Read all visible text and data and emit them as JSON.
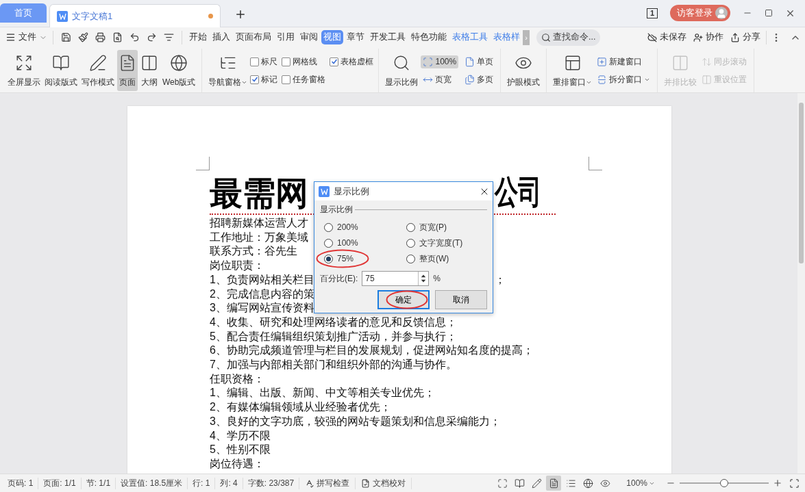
{
  "tabs": [
    {
      "label": "首页",
      "selected": false,
      "modified": false
    },
    {
      "label": "文字文稿1",
      "selected": true,
      "modified": true
    }
  ],
  "page_count_badge": "1",
  "login_button": "访客登录",
  "file_menu": "文件",
  "menu_tabs": [
    {
      "label": "开始",
      "selected": false,
      "contextual": false
    },
    {
      "label": "插入",
      "selected": false,
      "contextual": false
    },
    {
      "label": "页面布局",
      "selected": false,
      "contextual": false
    },
    {
      "label": "引用",
      "selected": false,
      "contextual": false
    },
    {
      "label": "审阅",
      "selected": false,
      "contextual": false
    },
    {
      "label": "视图",
      "selected": true,
      "contextual": false
    },
    {
      "label": "章节",
      "selected": false,
      "contextual": false
    },
    {
      "label": "开发工具",
      "selected": false,
      "contextual": false
    },
    {
      "label": "特色功能",
      "selected": false,
      "contextual": false
    },
    {
      "label": "表格工具",
      "selected": false,
      "contextual": true
    },
    {
      "label": "表格样",
      "selected": false,
      "contextual": true
    }
  ],
  "more_tabs": "›",
  "command_search": {
    "placeholder": "查找命令..."
  },
  "actions": [
    "未保存",
    "协作",
    "分享"
  ],
  "ribbon": {
    "groups": [
      {
        "items": [
          {
            "kind": "large",
            "label": "全屏显示",
            "selected": false
          },
          {
            "kind": "large",
            "label": "阅读版式",
            "selected": false
          },
          {
            "kind": "large",
            "label": "写作模式",
            "selected": false
          },
          {
            "kind": "large",
            "label": "页面",
            "selected": true
          },
          {
            "kind": "large",
            "label": "大纲",
            "selected": false
          },
          {
            "kind": "large",
            "label": "Web版式",
            "selected": false
          }
        ]
      },
      {
        "items": [
          {
            "kind": "large",
            "label": "导航窗格",
            "dropdown": true
          },
          {
            "kind": "check",
            "label": "标尺",
            "checked": false
          },
          {
            "kind": "check",
            "label": "标记",
            "checked": true
          },
          {
            "kind": "check",
            "label": "网格线",
            "checked": false
          },
          {
            "kind": "check",
            "label": "任务窗格",
            "checked": false
          },
          {
            "kind": "check",
            "label": "表格虚框",
            "checked": true
          }
        ]
      },
      {
        "items": [
          {
            "kind": "large",
            "label": "显示比例"
          },
          {
            "kind": "small",
            "label": "100%",
            "selected": true
          },
          {
            "kind": "small",
            "label": "页宽",
            "selected": false
          },
          {
            "kind": "small",
            "label": "单页",
            "selected": false
          },
          {
            "kind": "small",
            "label": "多页",
            "selected": false
          }
        ]
      },
      {
        "items": [
          {
            "kind": "large",
            "label": "护眼模式"
          }
        ]
      },
      {
        "items": [
          {
            "kind": "large",
            "label": "重排窗口",
            "dropdown": true
          },
          {
            "kind": "small",
            "label": "新建窗口",
            "dropdown": false
          },
          {
            "kind": "small",
            "label": "拆分窗口",
            "dropdown": true
          }
        ]
      },
      {
        "items": [
          {
            "kind": "large",
            "label": "并排比较",
            "disabled": true
          },
          {
            "kind": "small",
            "label": "同步滚动",
            "disabled": true
          },
          {
            "kind": "small",
            "label": "重设位置",
            "disabled": true
          }
        ]
      }
    ]
  },
  "document": {
    "title_left": "最需网",
    "title_right": "公司",
    "lines": [
      {
        "text": "招聘新媒体运营人才"
      },
      {
        "text": "工作地址：万象美域"
      },
      {
        "text": "联系方式：谷先生"
      },
      {
        "text": "岗位职责："
      },
      {
        "text": "1、负责网站相关栏目",
        "tail": "；"
      },
      {
        "text": "2、完成信息内容的策"
      },
      {
        "text": "3、编写网站宣传资料"
      },
      {
        "text": "4、收集、研究和处理网络读者的意见和反馈信息；"
      },
      {
        "text": "5、配合责任编辑组织策划推广活动，并参与执行；"
      },
      {
        "text": "6、协助完成频道管理与栏目的发展规划，促进网站知名度的提高；"
      },
      {
        "text": "7、加强与内部相关部门和组织外部的沟通与协作。"
      },
      {
        "text": "任职资格："
      },
      {
        "text": "1、编辑、出版、新闻、中文等相关专业优先；"
      },
      {
        "text": "2、有媒体编辑领域从业经验者优先；"
      },
      {
        "text": "3、良好的文字功底，较强的网站专题策划和信息采编能力；"
      },
      {
        "text": "4、学历不限"
      },
      {
        "text": "5、性别不限"
      },
      {
        "text": "岗位待遇："
      }
    ]
  },
  "dialog": {
    "title": "显示比例",
    "group_label": "显示比例",
    "options": [
      {
        "label": "200%",
        "selected": false,
        "circled": false
      },
      {
        "label": "页宽(P)",
        "selected": false,
        "circled": false
      },
      {
        "label": "100%",
        "selected": false,
        "circled": false
      },
      {
        "label": "文字宽度(T)",
        "selected": false,
        "circled": false
      },
      {
        "label": "75%",
        "selected": true,
        "circled": true
      },
      {
        "label": "整页(W)",
        "selected": false,
        "circled": false
      }
    ],
    "percent_label": "百分比(E):",
    "percent_value": "75",
    "percent_unit": "%",
    "buttons": [
      {
        "label": "确定",
        "default": true,
        "circled": true
      },
      {
        "label": "取消",
        "default": false,
        "circled": false
      }
    ]
  },
  "status_bar": {
    "fields": [
      "页码: 1",
      "页面: 1/1",
      "节: 1/1",
      "设置值: 18.5厘米",
      "行: 1",
      "列: 4",
      "字数: 23/387"
    ],
    "spell_check": "拼写检查",
    "proofread": "文档校对",
    "view_modes": [
      {
        "selected": false
      },
      {
        "selected": false
      },
      {
        "selected": false
      },
      {
        "selected": true
      },
      {
        "selected": false
      },
      {
        "selected": false
      },
      {
        "selected": false
      }
    ],
    "zoom": "100%",
    "zoom_slider": {
      "level": 0.5
    }
  }
}
